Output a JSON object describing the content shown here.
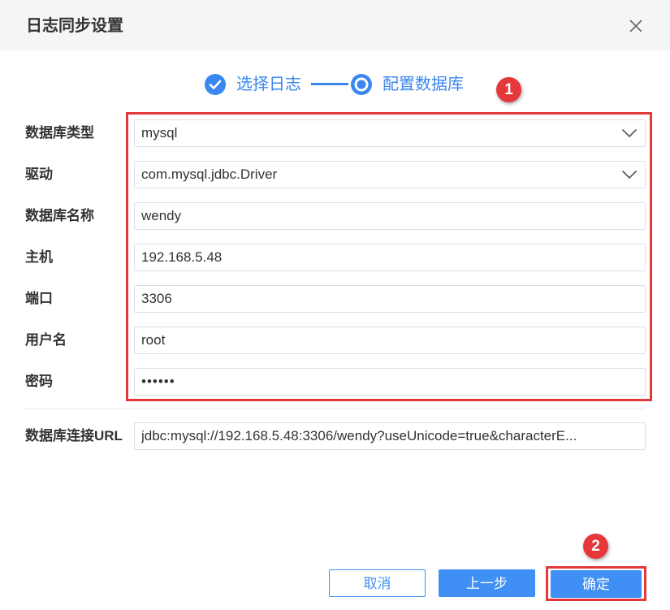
{
  "dialog": {
    "title": "日志同步设置",
    "close_icon": "close-icon"
  },
  "steps": {
    "items": [
      {
        "label": "选择日志",
        "icon": "check-circle-icon"
      },
      {
        "label": "配置数据库",
        "icon": "radio-dot-icon"
      }
    ]
  },
  "form": {
    "fields": [
      {
        "label": "数据库类型",
        "value": "mysql",
        "icon": "chevron-down-icon"
      },
      {
        "label": "驱动",
        "value": "com.mysql.jdbc.Driver",
        "icon": "chevron-down-icon"
      },
      {
        "label": "数据库名称",
        "value": "wendy"
      },
      {
        "label": "主机",
        "value": "192.168.5.48"
      },
      {
        "label": "端口",
        "value": "3306"
      },
      {
        "label": "用户名",
        "value": "root"
      },
      {
        "label": "密码",
        "value": "••••••"
      }
    ],
    "url": {
      "label": "数据库连接URL",
      "value": "jdbc:mysql://192.168.5.48:3306/wendy?useUnicode=true&characterE..."
    }
  },
  "buttons": {
    "cancel": "取消",
    "previous": "上一步",
    "confirm": "确定"
  },
  "annotations": [
    {
      "label": "1"
    },
    {
      "label": "2"
    }
  ],
  "colors": {
    "primary": "#3f8ff4",
    "step": "#3a87ef",
    "annotation": "#e6373b",
    "header_bg": "#f4f5f7",
    "field_border": "#dcdfe6"
  }
}
